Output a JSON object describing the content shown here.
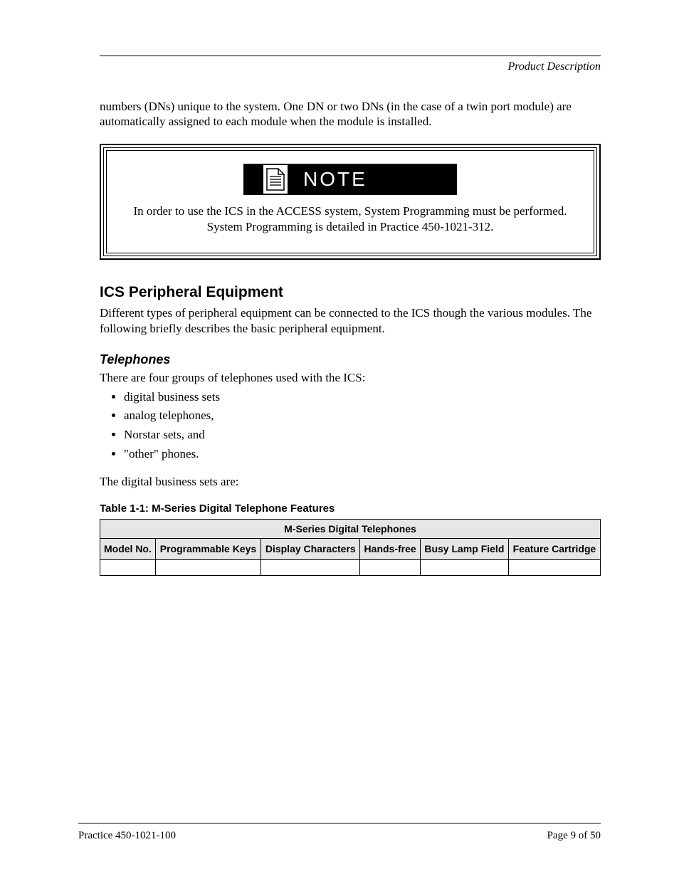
{
  "header": {
    "running_title": "Product Description"
  },
  "intro": "numbers (DNs) unique to the system. One DN or two DNs (in the case of a twin port module) are automatically assigned to each module when the module is installed.",
  "note": {
    "label": "NOTE",
    "text": "In order to use the ICS in the ACCESS system, System Programming must be performed. System Programming is detailed in Practice 450-1021-312."
  },
  "section": {
    "heading": "ICS Peripheral Equipment",
    "text": "Different types of peripheral equipment can be connected to the ICS though the various modules. The following briefly describes the basic peripheral equipment."
  },
  "telephones": {
    "heading": "Telephones",
    "intro": "There are four groups of telephones used with the ICS:",
    "groups": [
      "digital business sets",
      "analog telephones,",
      "Norstar sets, and",
      "\"other\" phones."
    ],
    "digital_sets_intro": "The digital business sets are:",
    "table_caption": "Table 1-1: M-Series Digital Telephone Features",
    "table": {
      "title": "M-Series Digital Telephones",
      "columns": [
        "Model No.",
        "Programmable Keys",
        "Display Characters",
        "Hands-free",
        "Busy Lamp Field",
        "Feature Cartridge"
      ],
      "rows": [
        [
          "",
          "",
          "",
          "",
          "",
          ""
        ]
      ]
    }
  },
  "footer": {
    "left": "Practice 450-1021-100",
    "right": "Page 9 of 50"
  }
}
